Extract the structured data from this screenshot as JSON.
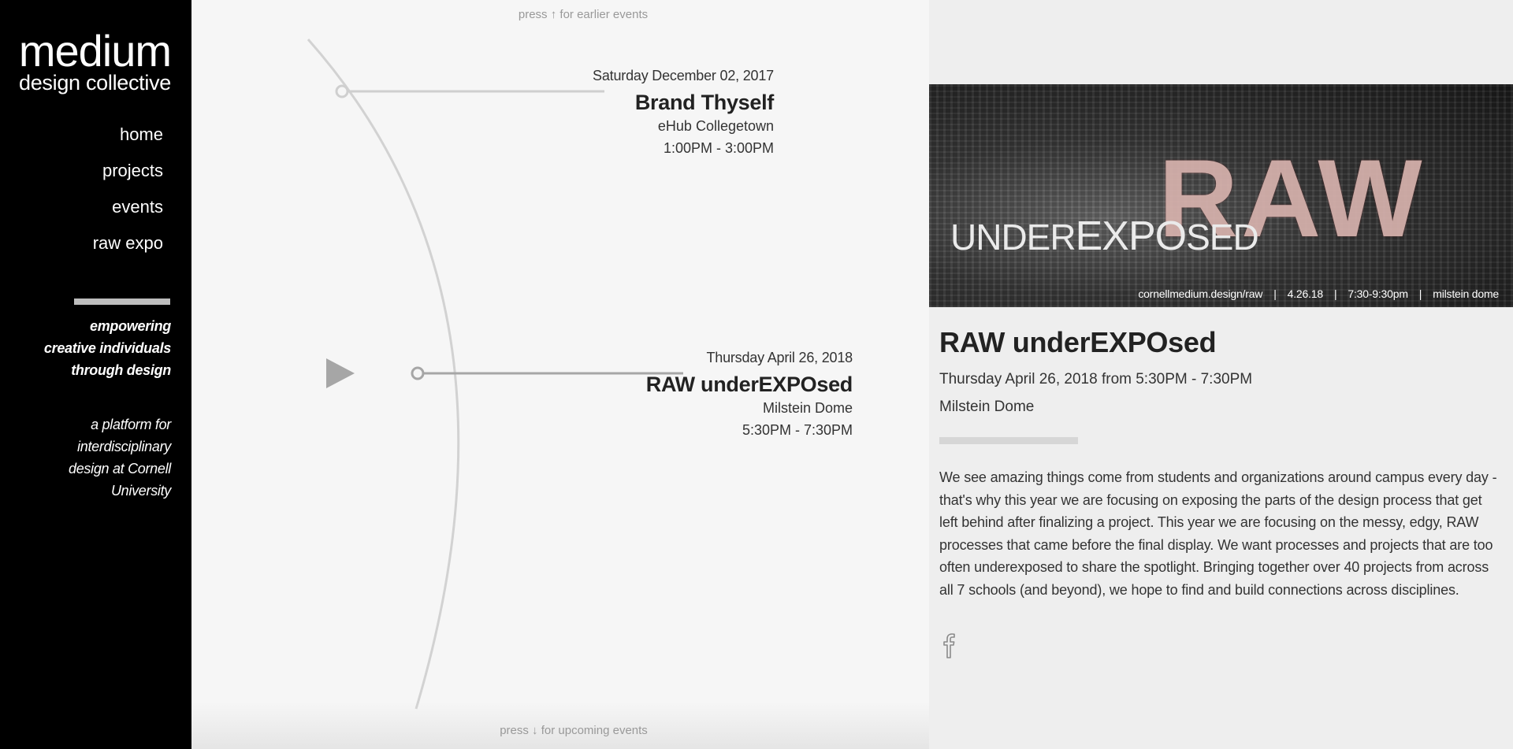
{
  "sidebar": {
    "logo_main": "medium",
    "logo_sub": "design collective",
    "nav": [
      "home",
      "projects",
      "events",
      "raw expo"
    ],
    "tagline_1": [
      "empowering",
      "creative individuals",
      "through design"
    ],
    "tagline_2": [
      "a platform for",
      "interdisciplinary",
      "design at Cornell",
      "University"
    ]
  },
  "timeline": {
    "hint_top": {
      "prefix": "press",
      "arrow": "↑",
      "suffix": "for earlier events"
    },
    "hint_bottom": {
      "prefix": "press",
      "arrow": "↓",
      "suffix": "for upcoming events"
    },
    "events": [
      {
        "date": "Saturday December 02, 2017",
        "title": "Brand Thyself",
        "venue": "eHub Collegetown",
        "time": "1:00PM - 3:00PM"
      },
      {
        "date": "Thursday April 26, 2018",
        "title": "RAW underEXPOsed",
        "venue": "Milstein Dome",
        "time": "5:30PM - 7:30PM"
      }
    ]
  },
  "detail": {
    "banner": {
      "raw": "RAW",
      "under_a": "UND",
      "under_b": "ER",
      "under_c": "EXPO",
      "under_d": "SED",
      "footer": [
        "cornellmedium.design/raw",
        "4.26.18",
        "7:30-9:30pm",
        "milstein dome"
      ],
      "separator": "|"
    },
    "title": "RAW underEXPOsed",
    "datetime": "Thursday April 26, 2018 from 5:30PM - 7:30PM",
    "venue": "Milstein Dome",
    "description": "We see amazing things come from students and organizations around campus every day - that's why this year we are focusing on exposing the parts of the design process that get left behind after finalizing a project. This year we are focusing on the messy, edgy, RAW processes that came before the final display. We want processes and projects that are too often underexposed to share the spotlight. Bringing together over 40 projects from across all 7 schools (and beyond), we hope to find and build connections across disciplines.",
    "social_icon": "facebook-icon"
  },
  "colors": {
    "sidebar_bg": "#000000",
    "timeline_bg": "#f6f6f6",
    "detail_bg": "#eeeeee",
    "arc": "#cccccc",
    "indicator": "#a6a6a6"
  }
}
